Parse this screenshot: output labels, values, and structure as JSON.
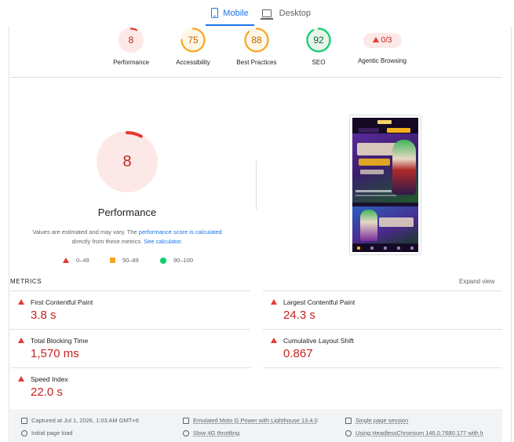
{
  "tabs": {
    "mobile": "Mobile",
    "desktop": "Desktop"
  },
  "gauges": [
    {
      "label": "Performance",
      "score": "8",
      "value": 8,
      "color": "#e53935",
      "fill": "#fce8e6",
      "text_color": "#c5221f"
    },
    {
      "label": "Accessibility",
      "score": "75",
      "value": 75,
      "color": "#f5a623",
      "fill": "#fff7e6",
      "text_color": "#c26401"
    },
    {
      "label": "Best Practices",
      "score": "88",
      "value": 88,
      "color": "#f5a623",
      "fill": "#fff7e6",
      "text_color": "#c26401"
    },
    {
      "label": "SEO",
      "score": "92",
      "value": 92,
      "color": "#0cce6b",
      "fill": "#e6f4ea",
      "text_color": "#0d652d"
    }
  ],
  "agentic": {
    "label": "Agentic Browsing",
    "score": "0/3"
  },
  "main": {
    "score": "8",
    "value": 8,
    "title": "Performance",
    "note_prefix": "Values are estimated and may vary. The ",
    "note_link1": "performance score is calculated",
    "note_middle": "directly from these metrics. ",
    "note_link2": "See calculator."
  },
  "legend": {
    "poor": "0–49",
    "average": "50–89",
    "good": "90–100"
  },
  "metrics": {
    "title": "METRICS",
    "expand": "Expand view",
    "items": [
      {
        "name": "First Contentful Paint",
        "value": "3.8 s"
      },
      {
        "name": "Largest Contentful Paint",
        "value": "24.3 s"
      },
      {
        "name": "Total Blocking Time",
        "value": "1,570 ms"
      },
      {
        "name": "Cumulative Layout Shift",
        "value": "0.867"
      },
      {
        "name": "Speed Index",
        "value": "22.0 s"
      }
    ]
  },
  "info": {
    "captured": "Captured at Jul 1, 2026, 1:03 AM GMT+6",
    "initial": "Initial page load",
    "device": "Emulated Moto G Power with Lighthouse 13.4.0",
    "throttle": "Slow 4G throttling",
    "session": "Single page session",
    "browser": "Using HeadlessChromium 146.0.7680.177 with lr"
  }
}
